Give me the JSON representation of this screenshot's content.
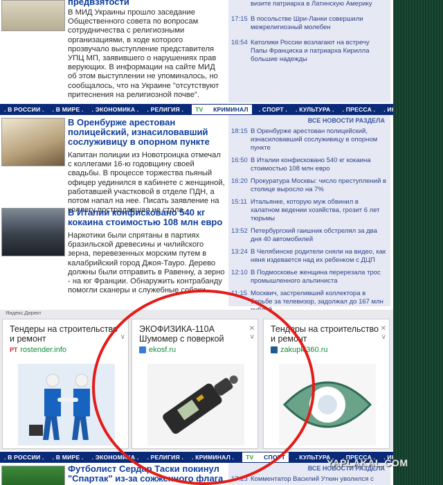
{
  "top_section": {
    "headline": "предвзятости",
    "body": "В МИД Украины прошло заседание Общественного совета по вопросам сотрудничества с религиозными организациями, в ходе которого прозвучало выступление представителя УПЦ МП, заявившего о нарушениях прав верующих. В информации на сайте МИД об этом выступлении не упоминалось, но сообщалось, что на Украине \"отсутствуют притеснения на религиозной почве\".",
    "news": [
      {
        "time": "",
        "text": "визите патриарха в Латинскую Америку"
      },
      {
        "time": "17:15",
        "text": "В посольстве Шри-Ланки совершили межрелигиозный молебен"
      },
      {
        "time": "16:54",
        "text": "Католики России возлагают на встречу Папы Франциска и патриарха Кирилла большие надежды"
      }
    ]
  },
  "rubric_bar_1": {
    "items": [
      ". В РОССИИ .",
      ". В МИРЕ .",
      ". ЭКОНОМИКА .",
      ". РЕЛИГИЯ .",
      "КРИМИНАЛ",
      ". СПОРТ .",
      ". КУЛЬТУРА .",
      ". ПРЕССА .",
      ". ИНОПРЕССА ."
    ],
    "tv_label": "TV"
  },
  "crime_section": {
    "all_news_label": "ВСЕ НОВОСТИ РАЗДЕЛА",
    "article1": {
      "headline": "В Оренбурже арестован полицейский, изнасиловавший сослуживицу в опорном пункте",
      "body": "Капитан полиции из Новотроицка отмечал с коллегами 16-ю годовщину своей свадьбы. В процессе торжества пьяный офицер уединился в кабинете с женщиной, работавшей участковой в отделе ПДН, а потом напал на нее. Писать заявление на коллегу пострадавшая не стала."
    },
    "article2": {
      "headline": "В Италии конфисковано 540 кг кокаина стоимостью 108 млн евро",
      "body": "Наркотики были спрятаны в партиях бразильской древесины и чилийского зерна, перевезенных морским путем в калабрийский город Джоя-Тауро. Дерево должны были отправить в Равенну, а зерно - на юг Франции. Обнаружить контрабанду помогли сканеры и служебные собаки."
    },
    "news": [
      {
        "time": "18:15",
        "text": "В Оренбурже арестован полицейский, изнасиловавший сослуживицу в опорном пункте"
      },
      {
        "time": "16:50",
        "text": "В Италии конфисковано 540 кг кокаина стоимостью 108 млн евро"
      },
      {
        "time": "16:20",
        "text": "Прокуратура Москвы: число преступлений в столице выросло на 7%"
      },
      {
        "time": "15:11",
        "text": "Итальянке, которую муж обвинил в халатном ведении хозяйства, грозит 6 лет тюрьмы"
      },
      {
        "time": "13:52",
        "text": "Петербургский гаишник обстрелял за два дня 40 автомобилей"
      },
      {
        "time": "13:24",
        "text": "В Челябинске родители сняли на видео, как няня издевается над их ребенком с ДЦП"
      },
      {
        "time": "12:10",
        "text": "В Подмосковье женщина перерезала трос промышленного альпиниста"
      },
      {
        "time": "11:15",
        "text": "Москвич, застреливший коллектора в борьбе за телевизор, задолжал до 167 млн рублей"
      }
    ]
  },
  "yandex_direct": {
    "label": "Яндекс.Директ",
    "ads": [
      {
        "title": "Тендеры на строительство и ремонт",
        "domain": "rostender.info",
        "favicon_color": "#d9262b",
        "favicon_text": "РТ"
      },
      {
        "title": "ЭКОФИЗИКА-110А Шумомер с поверкой",
        "domain": "ekosf.ru",
        "favicon_color": "#3a7bd5",
        "favicon_text": ""
      },
      {
        "title": "Тендеры на строительство и ремонт",
        "domain": "zakupki360.ru",
        "favicon_color": "#1f5b8f",
        "favicon_text": ""
      }
    ]
  },
  "rubric_bar_2": {
    "items": [
      ". В РОССИИ .",
      ". В МИРЕ .",
      ". ЭКОНОМИКА .",
      ". РЕЛИГИЯ .",
      ". КРИМИНАЛ .",
      "СПОРТ",
      ". КУЛЬТУРА .",
      ". ПРЕССА .",
      ". ИНОПРЕССА ."
    ],
    "tv_label": "TV"
  },
  "sport_section": {
    "headline": "Футболист Сердар Таски покинул \"Спартак\" из-за сожженного флага Турции",
    "all_news_label": "ВСЕ НОВОСТИ РАЗДЕЛА",
    "news": [
      {
        "time": "17:23",
        "text": "Комментатор Василий Уткин уволился с"
      }
    ]
  },
  "watermark": "YAPLAKAL.COM"
}
